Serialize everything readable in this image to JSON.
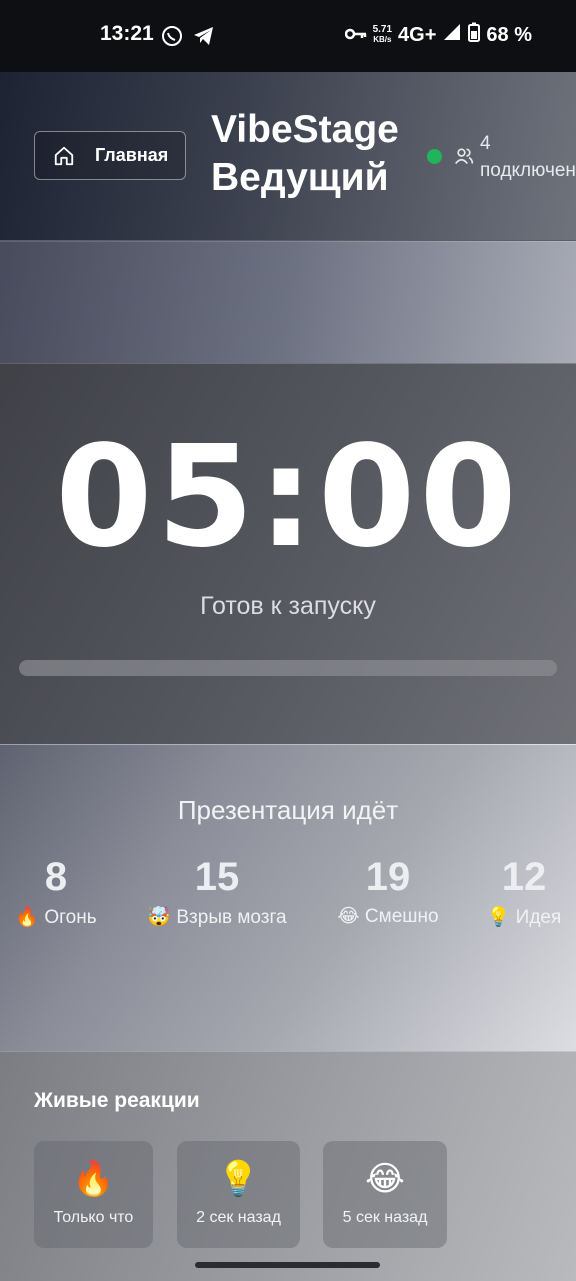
{
  "status_bar": {
    "time": "13:21",
    "speed_value": "5.71",
    "speed_unit": "KB/s",
    "network": "4G+",
    "battery": "68 %"
  },
  "header": {
    "home_label": "Главная",
    "title_line1": "VibeStage",
    "title_line2": "Ведущий",
    "connections_count": "4",
    "connections_label": "подключения",
    "online_color": "#22b45a"
  },
  "timer": {
    "display": "05:00",
    "status": "Готов к запуску",
    "progress": 0
  },
  "stats": {
    "title": "Презентация идёт",
    "items": [
      {
        "count": "8",
        "emoji": "🔥",
        "label": "Огонь"
      },
      {
        "count": "15",
        "emoji": "🤯",
        "label": "Взрыв мозга"
      },
      {
        "count": "19",
        "emoji": "😂",
        "label": "Смешно"
      },
      {
        "count": "12",
        "emoji": "💡",
        "label": "Идея"
      }
    ]
  },
  "reactions": {
    "title": "Живые реакции",
    "items": [
      {
        "emoji": "🔥",
        "time": "Только что"
      },
      {
        "emoji": "💡",
        "time": "2 сек назад"
      },
      {
        "emoji": "😂",
        "time": "5 сек назад"
      }
    ]
  }
}
